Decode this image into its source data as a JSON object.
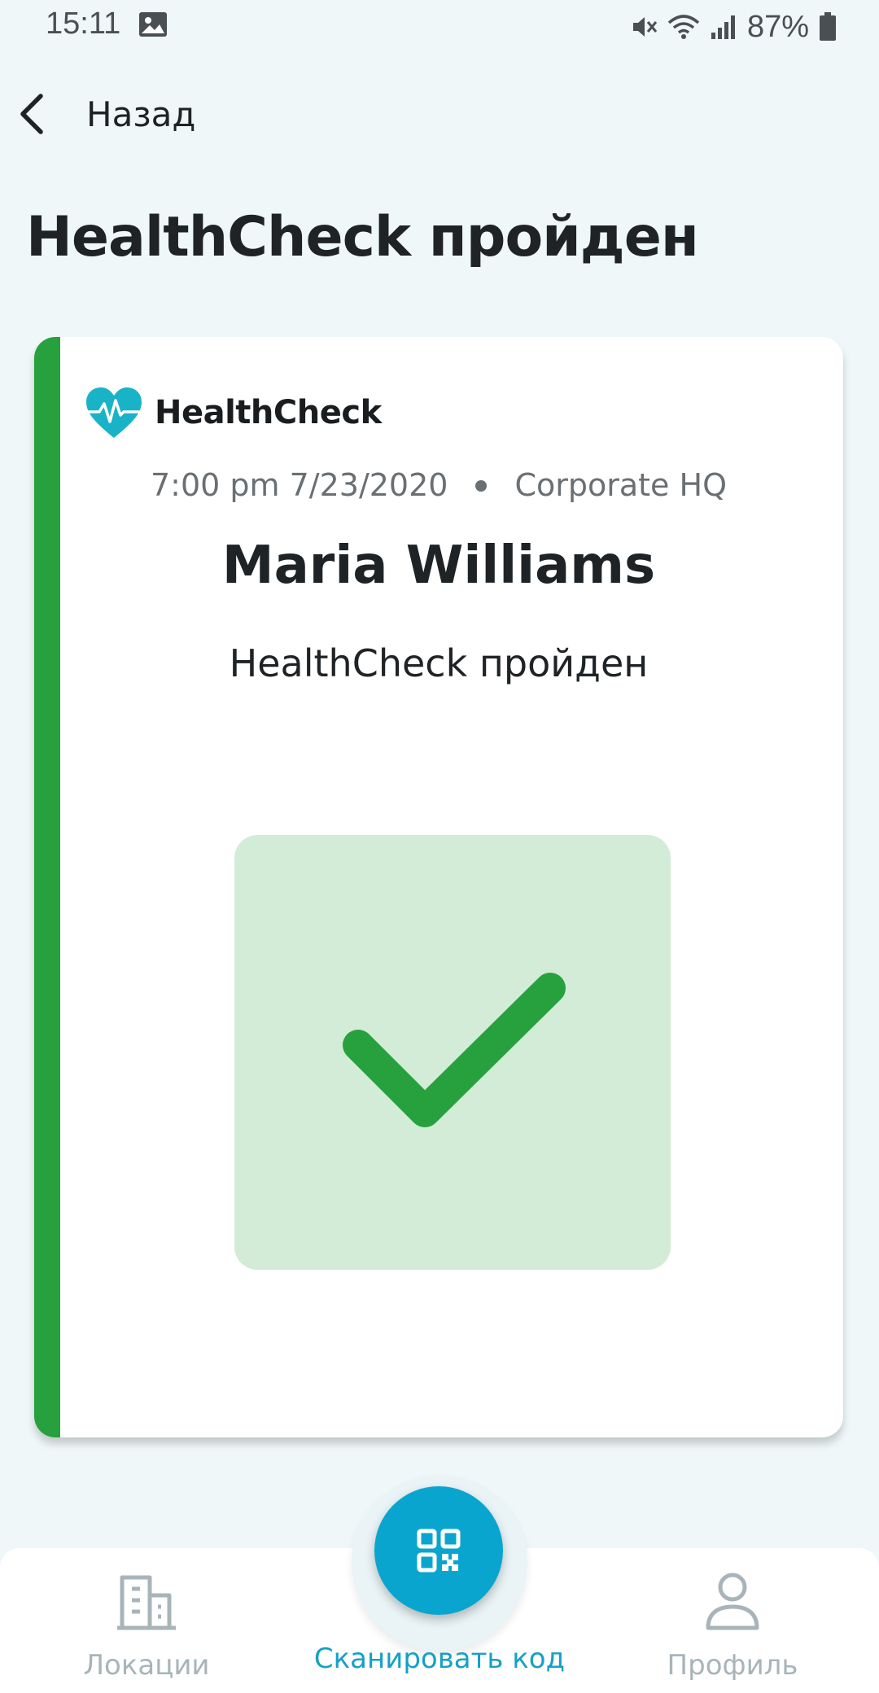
{
  "status_bar": {
    "time": "15:11",
    "battery": "87%",
    "icons": [
      "image-icon",
      "mute-icon",
      "wifi-icon",
      "signal-icon",
      "battery-icon"
    ]
  },
  "header": {
    "back_label": "Назад",
    "title": "HealthCheck пройден"
  },
  "card": {
    "accent_color": "#27a13e",
    "brand_name": "HealthCheck",
    "brand_color": "#19b3c8",
    "time": "7:00 pm 7/23/2020",
    "location": "Corporate HQ",
    "person_name": "Maria Williams",
    "status": "HealthCheck пройден",
    "result_icon": "checkmark-icon",
    "result_bg": "#d3ecd7",
    "result_color": "#27a13e"
  },
  "bottom_nav": {
    "items": [
      {
        "label": "Локации",
        "icon": "building-icon",
        "active": false
      },
      {
        "label": "Сканировать код",
        "icon": "qr-code-icon",
        "active": true
      },
      {
        "label": "Профиль",
        "icon": "person-icon",
        "active": false
      }
    ],
    "active_color": "#16a0c6",
    "inactive_color": "#a9b4ba",
    "fab_color": "#0aa5cf"
  }
}
